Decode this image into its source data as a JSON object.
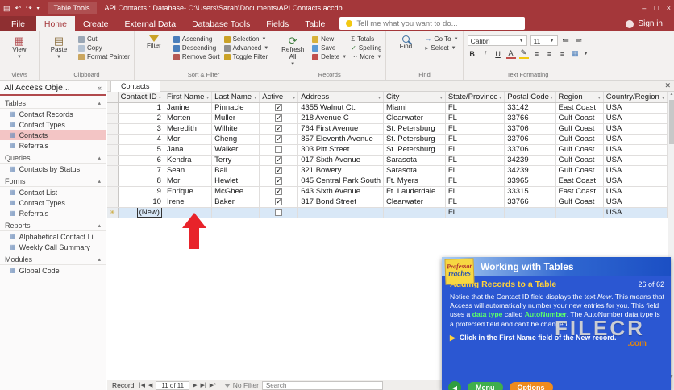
{
  "titlebar": {
    "tool_tab": "Table Tools",
    "title": "API Contacts : Database- C:\\Users\\Sarah\\Documents\\API Contacts.accdb"
  },
  "tabs": {
    "file": "File",
    "items": [
      "Home",
      "Create",
      "External Data",
      "Database Tools"
    ],
    "contextual": [
      "Fields",
      "Table"
    ],
    "tellme": "Tell me what you want to do...",
    "signin": "Sign in"
  },
  "ribbon": {
    "views": {
      "view": "View",
      "label": "Views"
    },
    "clipboard": {
      "paste": "Paste",
      "cut": "Cut",
      "copy": "Copy",
      "format_painter": "Format Painter",
      "label": "Clipboard"
    },
    "sort_filter": {
      "filter": "Filter",
      "ascending": "Ascending",
      "descending": "Descending",
      "remove_sort": "Remove Sort",
      "selection": "Selection",
      "advanced": "Advanced",
      "toggle_filter": "Toggle Filter",
      "label": "Sort & Filter"
    },
    "records": {
      "refresh": "Refresh All",
      "new": "New",
      "save": "Save",
      "delete": "Delete",
      "totals": "Totals",
      "spelling": "Spelling",
      "more": "More",
      "label": "Records"
    },
    "find": {
      "find": "Find",
      "goto": "Go To",
      "select": "Select",
      "label": "Find"
    },
    "text_formatting": {
      "font": "Calibri",
      "size": "11",
      "label": "Text Formatting"
    }
  },
  "navpane": {
    "title": "All Access Obje...",
    "sections": [
      {
        "name": "Tables",
        "items": [
          {
            "label": "Contact Records"
          },
          {
            "label": "Contact Types"
          },
          {
            "label": "Contacts",
            "selected": true
          },
          {
            "label": "Referrals"
          }
        ]
      },
      {
        "name": "Queries",
        "items": [
          {
            "label": "Contacts by Status"
          }
        ]
      },
      {
        "name": "Forms",
        "items": [
          {
            "label": "Contact List"
          },
          {
            "label": "Contact Types"
          },
          {
            "label": "Referrals"
          }
        ]
      },
      {
        "name": "Reports",
        "items": [
          {
            "label": "Alphabetical Contact Listing"
          },
          {
            "label": "Weekly Call Summary"
          }
        ]
      },
      {
        "name": "Modules",
        "items": [
          {
            "label": "Global Code"
          }
        ]
      }
    ]
  },
  "doc": {
    "tab": "Contacts"
  },
  "table": {
    "columns": [
      "Contact ID",
      "First Name",
      "Last Name",
      "Active",
      "Address",
      "City",
      "State/Province",
      "Postal Code",
      "Region",
      "Country/Region"
    ],
    "rows": [
      {
        "id": "1",
        "first": "Janine",
        "last": "Pinnacle",
        "active": true,
        "address": "4355 Walnut Ct.",
        "city": "Miami",
        "state": "FL",
        "postal": "33142",
        "region": "East Coast",
        "country": "USA"
      },
      {
        "id": "2",
        "first": "Morten",
        "last": "Muller",
        "active": true,
        "address": "218 Avenue C",
        "city": "Clearwater",
        "state": "FL",
        "postal": "33766",
        "region": "Gulf Coast",
        "country": "USA"
      },
      {
        "id": "3",
        "first": "Meredith",
        "last": "Wilhite",
        "active": true,
        "address": "764 First Avenue",
        "city": "St. Petersburg",
        "state": "FL",
        "postal": "33706",
        "region": "Gulf Coast",
        "country": "USA"
      },
      {
        "id": "4",
        "first": "Mor",
        "last": "Cheng",
        "active": true,
        "address": "857 Eleventh Avenue",
        "city": "St. Petersburg",
        "state": "FL",
        "postal": "33706",
        "region": "Gulf Coast",
        "country": "USA"
      },
      {
        "id": "5",
        "first": "Jana",
        "last": "Walker",
        "active": false,
        "address": "303 Pitt Street",
        "city": "St. Petersburg",
        "state": "FL",
        "postal": "33706",
        "region": "Gulf Coast",
        "country": "USA"
      },
      {
        "id": "6",
        "first": "Kendra",
        "last": "Terry",
        "active": true,
        "address": "017 Sixth Avenue",
        "city": "Sarasota",
        "state": "FL",
        "postal": "34239",
        "region": "Gulf Coast",
        "country": "USA"
      },
      {
        "id": "7",
        "first": "Sean",
        "last": "Ball",
        "active": true,
        "address": "321 Bowery",
        "city": "Sarasota",
        "state": "FL",
        "postal": "34239",
        "region": "Gulf Coast",
        "country": "USA"
      },
      {
        "id": "8",
        "first": "Mor",
        "last": "Hewlet",
        "active": true,
        "address": "045 Central Park South",
        "city": "Ft. Myers",
        "state": "FL",
        "postal": "33965",
        "region": "East Coast",
        "country": "USA"
      },
      {
        "id": "9",
        "first": "Enrique",
        "last": "McGhee",
        "active": true,
        "address": "643 Sixth Avenue",
        "city": "Ft. Lauderdale",
        "state": "FL",
        "postal": "33315",
        "region": "East Coast",
        "country": "USA"
      },
      {
        "id": "10",
        "first": "Irene",
        "last": "Baker",
        "active": true,
        "address": "317 Bond Street",
        "city": "Clearwater",
        "state": "FL",
        "postal": "33766",
        "region": "Gulf Coast",
        "country": "USA"
      }
    ],
    "new_row": {
      "id": "(New)",
      "state": "FL",
      "country": "USA"
    }
  },
  "recordnav": {
    "label": "Record:",
    "position": "11 of 11",
    "filter": "No Filter",
    "search_placeholder": "Search"
  },
  "tutorial": {
    "brand_top": "Professor",
    "brand_bottom": "teaches",
    "header": "Working with Tables",
    "lesson": "Adding Records to a Table",
    "page": "26 of 62",
    "body": [
      {
        "t": "Notice that the Contact ID field displays the text "
      },
      {
        "t": "New",
        "i": true
      },
      {
        "t": ". This means that Access will automatically number your new entries for you. This field uses a "
      },
      {
        "t": "data type",
        "h": true
      },
      {
        "t": " called "
      },
      {
        "t": "AutoNumber",
        "h": true
      },
      {
        "t": ". The AutoNumber data type is a protected field and can't be changed."
      }
    ],
    "action": "Click in the First Name field of the New record.",
    "menu": "Menu",
    "options": "Options"
  },
  "watermark": {
    "name": "FILECR",
    "tld": ".com"
  }
}
